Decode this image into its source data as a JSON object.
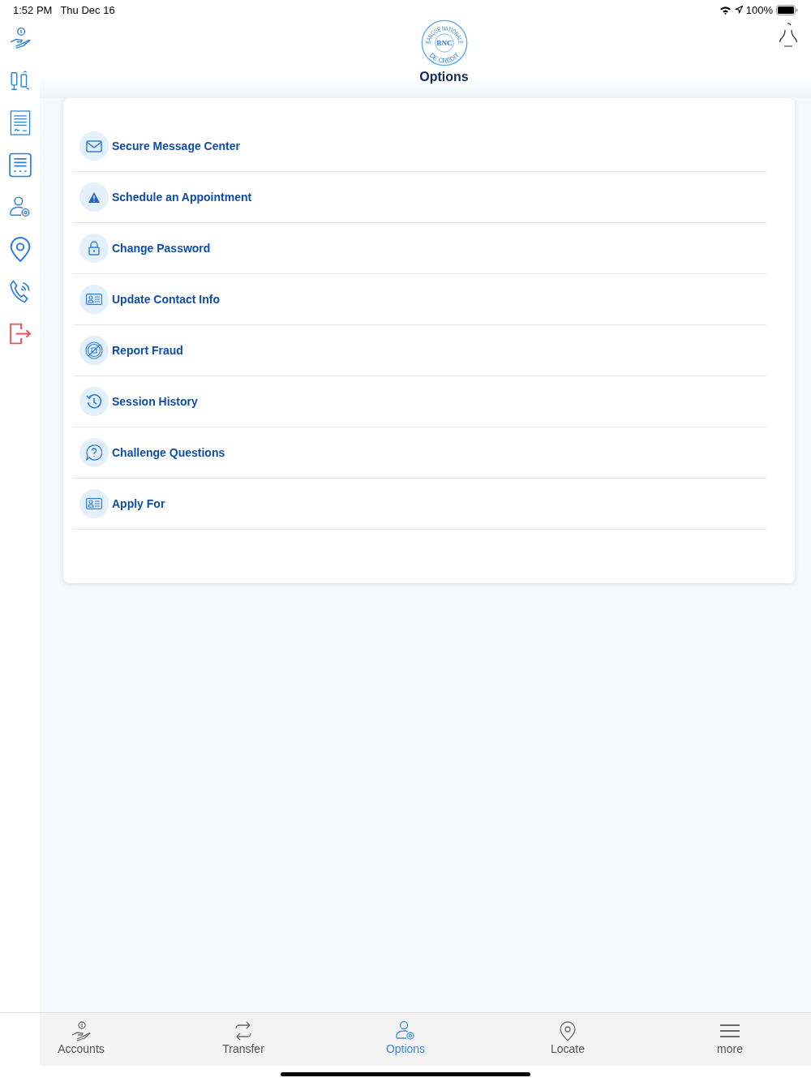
{
  "status_bar": {
    "time": "1:52 PM",
    "date": "Thu Dec 16",
    "battery": "100%"
  },
  "logo": {
    "initials": "BNC",
    "ring_top": "BANQUE NATIONALE",
    "ring_bottom": "DE CREDIT"
  },
  "title": "Options",
  "menu": [
    {
      "label": "Secure Message Center",
      "kind": "mail"
    },
    {
      "label": "Schedule an Appointment",
      "kind": "warning"
    },
    {
      "label": "Change Password",
      "kind": "lock"
    },
    {
      "label": "Update Contact Info",
      "kind": "card"
    },
    {
      "label": "Report Fraud",
      "kind": "fraud"
    },
    {
      "label": "Session History",
      "kind": "history"
    },
    {
      "label": "Challenge Questions",
      "kind": "question"
    },
    {
      "label": "Apply For",
      "kind": "card"
    }
  ],
  "tabs": [
    {
      "label": "Accounts",
      "kind": "accounts",
      "selected": false
    },
    {
      "label": "Transfer",
      "kind": "transfer",
      "selected": false
    },
    {
      "label": "Options",
      "kind": "options",
      "selected": true
    },
    {
      "label": "Locate",
      "kind": "locate",
      "selected": false
    },
    {
      "label": "more",
      "kind": "more",
      "selected": false
    }
  ]
}
